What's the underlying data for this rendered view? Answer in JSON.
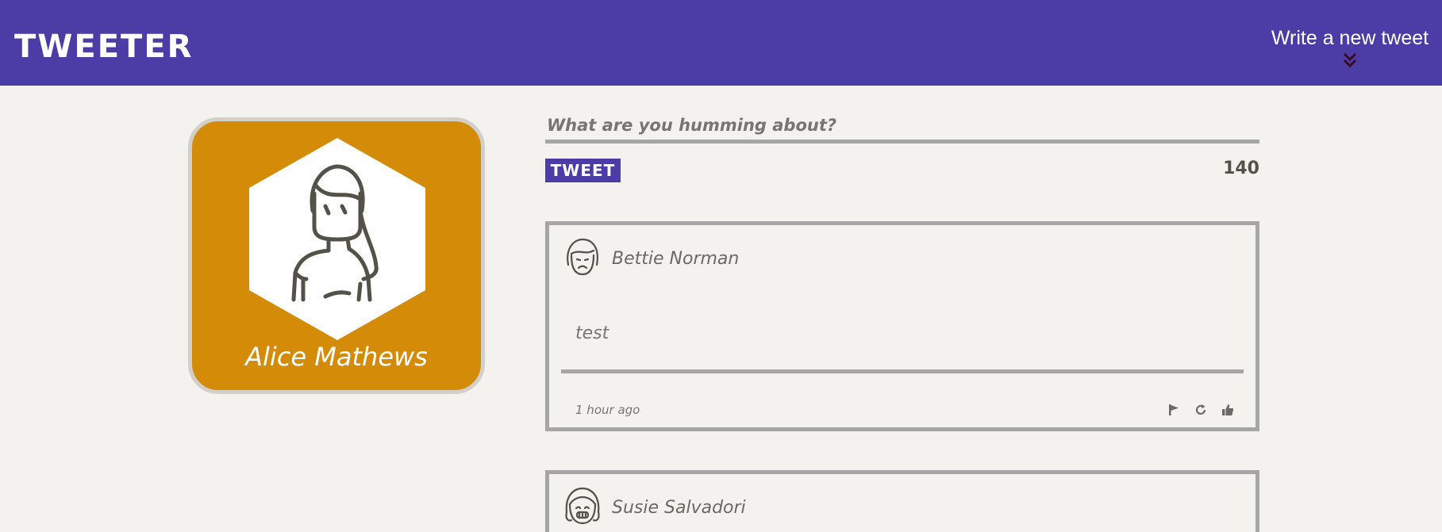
{
  "navbar": {
    "brand": "TWEETER",
    "compose_label": "Write a new tweet",
    "compose_icon": "double-chevron-down-icon",
    "background": "#4b3da5"
  },
  "profile": {
    "name": "Alice Mathews",
    "avatar_icon": "woman-avatar-icon",
    "card_color": "#d48c08"
  },
  "composer": {
    "placeholder": "What are you humming about?",
    "button_label": "TWEET",
    "counter": "140"
  },
  "tweets": [
    {
      "author": "Bettie Norman",
      "avatar_icon": "sad-woman-avatar-icon",
      "text": "test",
      "time": "1 hour ago",
      "actions": [
        "flag-icon",
        "retweet-icon",
        "like-icon"
      ]
    },
    {
      "author": "Susie Salvadori",
      "avatar_icon": "smiling-girl-avatar-icon"
    }
  ]
}
